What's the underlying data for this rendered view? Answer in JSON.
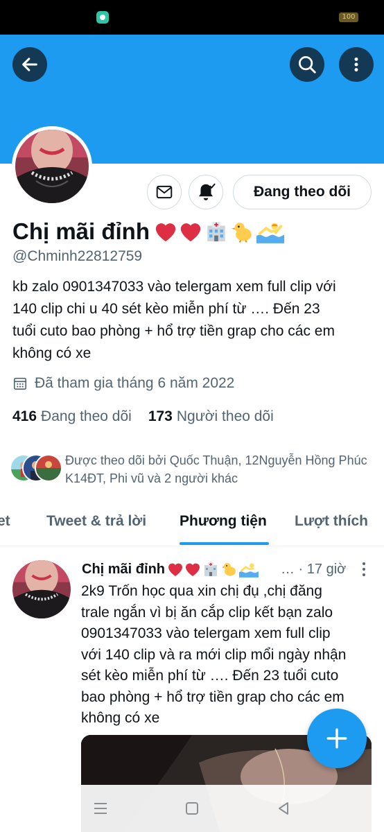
{
  "status_bar": {
    "battery": "100"
  },
  "profile": {
    "display_name": "Chị mãi đỉnh",
    "handle": "@Chminh22812759",
    "bio": "kb zalo 0901347033 vào telergam xem full clip với\n140 clip  chi u 40 sét kèo miễn phí từ …. Đến 23\ntuổi cuto bao phòng + hổ trợ tiền grap cho các em\nkhông có xe",
    "joined": "Đã tham gia tháng 6 năm 2022",
    "following_count": "416",
    "following_label": "Đang theo dõi",
    "followers_count": "173",
    "followers_label": "Người theo dõi",
    "followed_by": "Được theo dõi bởi Quốc Thuận, 12Nguyễn Hồng Phúc K14ĐT, Phi vũ và 2 người khác"
  },
  "actions": {
    "following_button": "Đang theo dõi"
  },
  "tabs": [
    {
      "label": "Tweet",
      "visible_text": "et"
    },
    {
      "label": "Tweet & trả lời"
    },
    {
      "label": "Phương tiện",
      "active": true
    },
    {
      "label": "Lượt thích"
    }
  ],
  "tweet": {
    "author": "Chị mãi đỉnh",
    "meta": "… · 17 giờ",
    "text": "2k9 Trốn học qua xin chị đụ ,chị đăng\ntrale ngắn vì bị ăn cắp clip kết bạn zalo\n0901347033 vào telergam xem full clip\nvới 140 clip và ra mới clip mổi ngày nhận\nsét kèo miễn phí từ …. Đến 23 tuổi cuto\nbao phòng + hổ trợ tiền grap cho  các em\nkhông có xe"
  },
  "icons": {
    "back": "arrow-left-icon",
    "search": "search-icon",
    "more": "more-vertical-icon",
    "mail": "mail-icon",
    "notifications": "bell-check-icon",
    "calendar": "calendar-icon",
    "compose": "plus-icon",
    "nav": [
      "recents-icon",
      "home-icon",
      "back-triangle-icon"
    ]
  },
  "colors": {
    "accent": "#1d9bf0",
    "text": "#0f1419",
    "secondary": "#536471",
    "heart": "#e0245e"
  }
}
